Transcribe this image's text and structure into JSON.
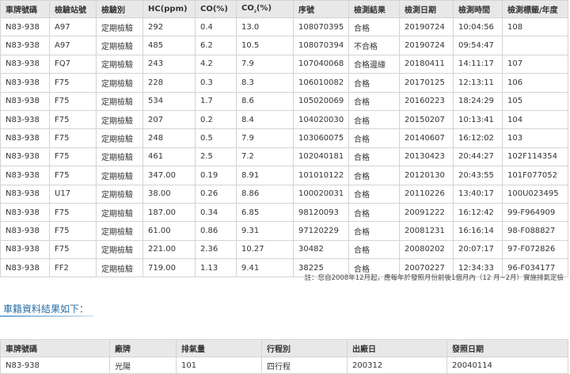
{
  "records": {
    "headers": [
      "車牌號碼",
      "檢驗站號",
      "檢驗別",
      "HC(ppm)",
      "CO(%)",
      "CO",
      "₂",
      "(%)",
      "序號",
      "檢測結果",
      "檢測日期",
      "檢測時間",
      "檢測標籤/年度"
    ],
    "rows": [
      [
        "N83-938",
        "A97",
        "定期檢驗",
        "292",
        "0.4",
        "13.0",
        "108070395",
        "合格",
        "20190724",
        "10:04:56",
        "108"
      ],
      [
        "N83-938",
        "A97",
        "定期檢驗",
        "485",
        "6.2",
        "10.5",
        "108070394",
        "不合格",
        "20190724",
        "09:54:47",
        ""
      ],
      [
        "N83-938",
        "FQ7",
        "定期檢驗",
        "243",
        "4.2",
        "7.9",
        "107040068",
        "合格邊緣",
        "20180411",
        "14:11:17",
        "107"
      ],
      [
        "N83-938",
        "F75",
        "定期檢驗",
        "228",
        "0.3",
        "8.3",
        "106010082",
        "合格",
        "20170125",
        "12:13:11",
        "106"
      ],
      [
        "N83-938",
        "F75",
        "定期檢驗",
        "534",
        "1.7",
        "8.6",
        "105020069",
        "合格",
        "20160223",
        "18:24:29",
        "105"
      ],
      [
        "N83-938",
        "F75",
        "定期檢驗",
        "207",
        "0.2",
        "8.4",
        "104020030",
        "合格",
        "20150207",
        "10:13:41",
        "104"
      ],
      [
        "N83-938",
        "F75",
        "定期檢驗",
        "248",
        "0.5",
        "7.9",
        "103060075",
        "合格",
        "20140607",
        "16:12:02",
        "103"
      ],
      [
        "N83-938",
        "F75",
        "定期檢驗",
        "461",
        "2.5",
        "7.2",
        "102040181",
        "合格",
        "20130423",
        "20:44:27",
        "102F114354"
      ],
      [
        "N83-938",
        "F75",
        "定期檢驗",
        "347.00",
        "0.19",
        "8.91",
        "101010122",
        "合格",
        "20120130",
        "20:43:55",
        "101F077052"
      ],
      [
        "N83-938",
        "U17",
        "定期檢驗",
        "38.00",
        "0.26",
        "8.86",
        "100020031",
        "合格",
        "20110226",
        "13:40:17",
        "100U023495"
      ],
      [
        "N83-938",
        "F75",
        "定期檢驗",
        "187.00",
        "0.34",
        "6.85",
        "98120093",
        "合格",
        "20091222",
        "16:12:42",
        "99-F964909"
      ],
      [
        "N83-938",
        "F75",
        "定期檢驗",
        "61.00",
        "0.86",
        "9.31",
        "97120229",
        "合格",
        "20081231",
        "16:16:14",
        "98-F088827"
      ],
      [
        "N83-938",
        "F75",
        "定期檢驗",
        "221.00",
        "2.36",
        "10.27",
        "30482",
        "合格",
        "20080202",
        "20:07:17",
        "97-F072826"
      ],
      [
        "N83-938",
        "FF2",
        "定期檢驗",
        "719.00",
        "1.13",
        "9.41",
        "38225",
        "合格",
        "20070227",
        "12:34:33",
        "96-F034177"
      ]
    ]
  },
  "note": "註：您自2008年12月起，應每年於發照月份前後1個月內（12 月~2月）實施排氣定檢",
  "vehicle": {
    "title": "車籍資料結果如下：",
    "headers": [
      "車牌號碼",
      "廠牌",
      "排氣量",
      "行程別",
      "出廠日",
      "發照日期"
    ],
    "row": [
      "N83-938",
      "光陽",
      "101",
      "四行程",
      "200312",
      "20040114"
    ]
  }
}
